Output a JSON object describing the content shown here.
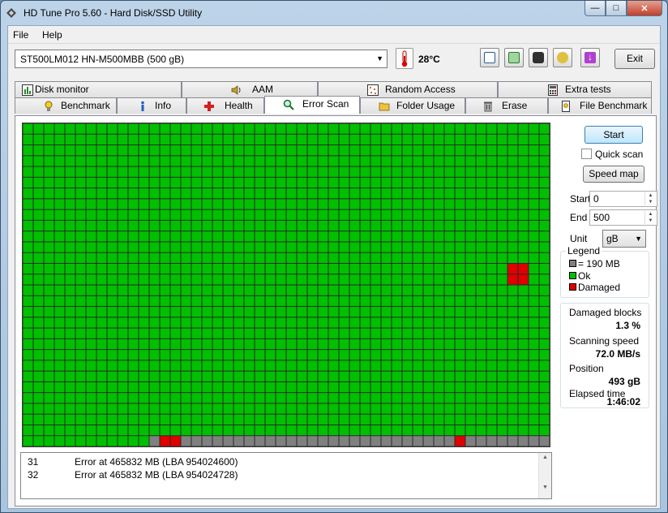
{
  "window": {
    "title": "HD Tune Pro 5.60 - Hard Disk/SSD Utility"
  },
  "menu": {
    "file": "File",
    "help": "Help"
  },
  "toolbar": {
    "drive": "ST500LM012 HN-M500MBB (500 gB)",
    "temperature": "28°C",
    "exit_label": "Exit"
  },
  "tabs_top": [
    {
      "label": "Disk monitor",
      "icon": "chart-icon"
    },
    {
      "label": "AAM",
      "icon": "speaker-icon"
    },
    {
      "label": "Random Access",
      "icon": "dots-icon"
    },
    {
      "label": "Extra tests",
      "icon": "calculator-icon"
    }
  ],
  "tabs_bottom": [
    {
      "label": "Benchmark",
      "icon": "bulb-icon"
    },
    {
      "label": "Info",
      "icon": "info-icon"
    },
    {
      "label": "Health",
      "icon": "cross-icon"
    },
    {
      "label": "Error Scan",
      "icon": "magnifier-icon",
      "active": true
    },
    {
      "label": "Folder Usage",
      "icon": "folder-icon"
    },
    {
      "label": "Erase",
      "icon": "trash-icon"
    },
    {
      "label": "File Benchmark",
      "icon": "file-icon"
    }
  ],
  "controls": {
    "start_label": "Start",
    "quick_scan_label": "Quick scan",
    "quick_scan_checked": false,
    "speed_map_label": "Speed map",
    "start_field_label": "Start",
    "start_value": "0",
    "end_field_label": "End",
    "end_value": "500",
    "unit_label": "Unit",
    "unit_value": "gB"
  },
  "legend": {
    "title": "Legend",
    "block_label": "= 190 MB",
    "ok_label": "Ok",
    "damaged_label": "Damaged",
    "colors": {
      "block": "#808080",
      "ok": "#00c000",
      "damaged": "#e00000"
    }
  },
  "stats": {
    "damaged_blocks_label": "Damaged blocks",
    "damaged_blocks_value": "1.3 %",
    "scanning_speed_label": "Scanning speed",
    "scanning_speed_value": "72.0 MB/s",
    "position_label": "Position",
    "position_value": "493 gB",
    "elapsed_label": "Elapsed time",
    "elapsed_value": "1:46:02"
  },
  "scan_map": {
    "columns": 50,
    "rows": 30,
    "scanned_blocks": 1462,
    "damaged_blocks": [
      [
        13,
        29
      ],
      [
        14,
        29
      ],
      [
        46,
        13
      ],
      [
        46,
        14
      ],
      [
        47,
        13
      ],
      [
        47,
        14
      ],
      [
        41,
        29
      ]
    ],
    "colors": {
      "ok": "#00c000",
      "damaged": "#e00000",
      "unscanned": "#808080",
      "line": "#2a2a2a"
    }
  },
  "log": [
    {
      "num": "31",
      "text": "Error at 465832 MB (LBA 954024600)"
    },
    {
      "num": "32",
      "text": "Error at 465832 MB (LBA 954024728)"
    }
  ]
}
